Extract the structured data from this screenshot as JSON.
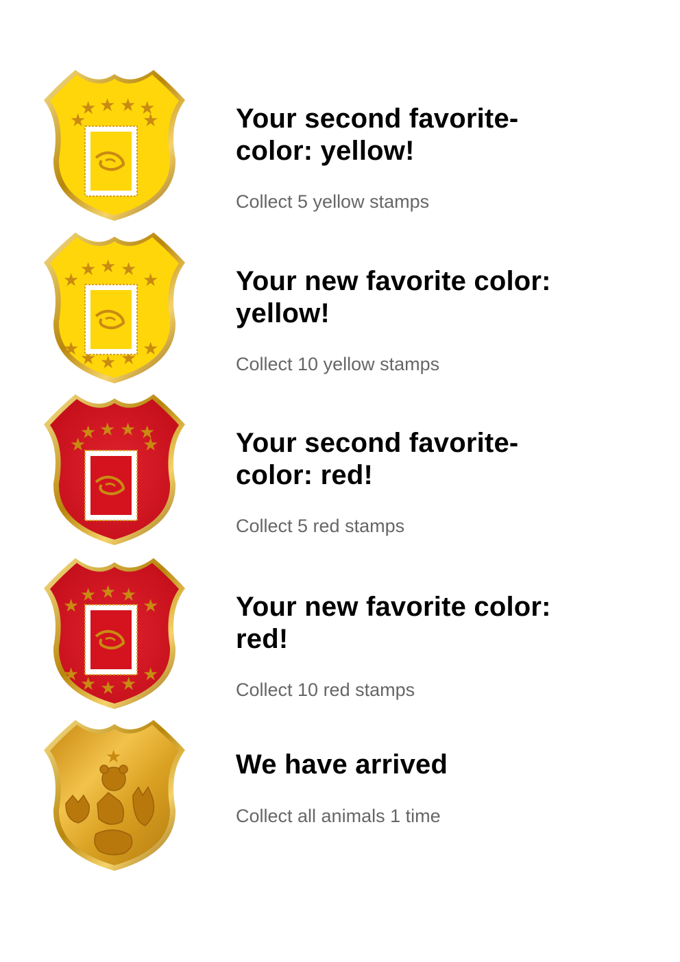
{
  "colors": {
    "yellow_fill": "#FFD60A",
    "red_fill": "#D4131F",
    "gold_fill": "#E3A922",
    "rim": "#B8860B",
    "star": "#C98A12",
    "title_text": "#000000",
    "description_text": "#666666"
  },
  "achievements": [
    {
      "title": "Your second favorite-color: yellow!",
      "description": "Collect 5 yellow stamps",
      "badge_color": "yellow",
      "star_count": 7,
      "icon": "yellow-stamp-badge-icon"
    },
    {
      "title": "Your new favorite color: yellow!",
      "description": "Collect 10 yellow stamps",
      "badge_color": "yellow",
      "star_count": 14,
      "icon": "yellow-stamp-badge-icon"
    },
    {
      "title": "Your second favorite-color: red!",
      "description": "Collect 5 red stamps",
      "badge_color": "red",
      "star_count": 7,
      "icon": "red-stamp-badge-icon"
    },
    {
      "title": "Your new favorite color: red!",
      "description": "Collect 10 red stamps",
      "badge_color": "red",
      "star_count": 14,
      "icon": "red-stamp-badge-icon"
    },
    {
      "title": "We have arrived",
      "description": "Collect all animals 1 time",
      "badge_color": "gold",
      "star_count": 1,
      "icon": "animals-badge-icon"
    }
  ]
}
